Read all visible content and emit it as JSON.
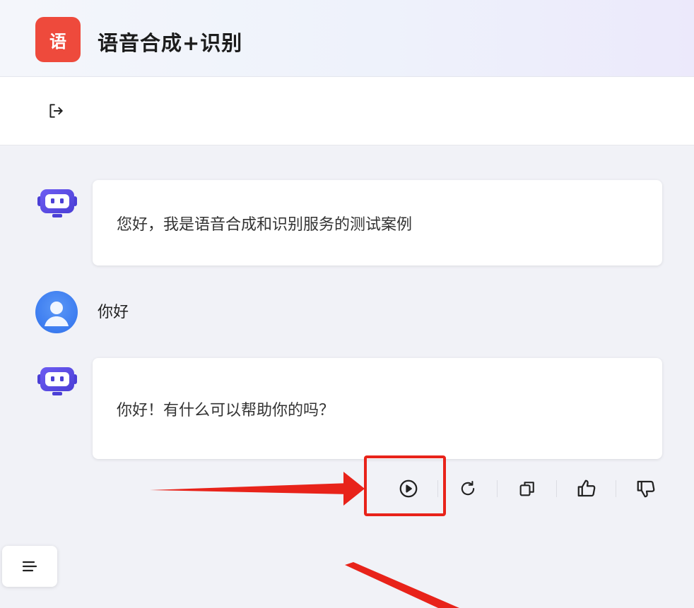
{
  "header": {
    "logo_text": "语",
    "title": "语音合成+识别"
  },
  "toolbar": {
    "logout_icon": "logout-icon"
  },
  "messages": [
    {
      "role": "bot",
      "text": "您好，我是语音合成和识别服务的测试案例"
    },
    {
      "role": "user",
      "text": "你好"
    },
    {
      "role": "bot",
      "text": "你好！有什么可以帮助你的吗？"
    }
  ],
  "actions": [
    {
      "name": "play",
      "icon": "play-circle-icon"
    },
    {
      "name": "regenerate",
      "icon": "refresh-icon"
    },
    {
      "name": "copy",
      "icon": "copy-icon"
    },
    {
      "name": "like",
      "icon": "thumbs-up-icon"
    },
    {
      "name": "dislike",
      "icon": "thumbs-down-icon"
    }
  ],
  "sidebar_toggle": {
    "icon": "menu-lines-icon"
  },
  "colors": {
    "logo_bg": "#ee4a3c",
    "bot_avatar": "#5b4fe0",
    "user_avatar": "#3c7cf0",
    "annotation": "#e8231a"
  }
}
